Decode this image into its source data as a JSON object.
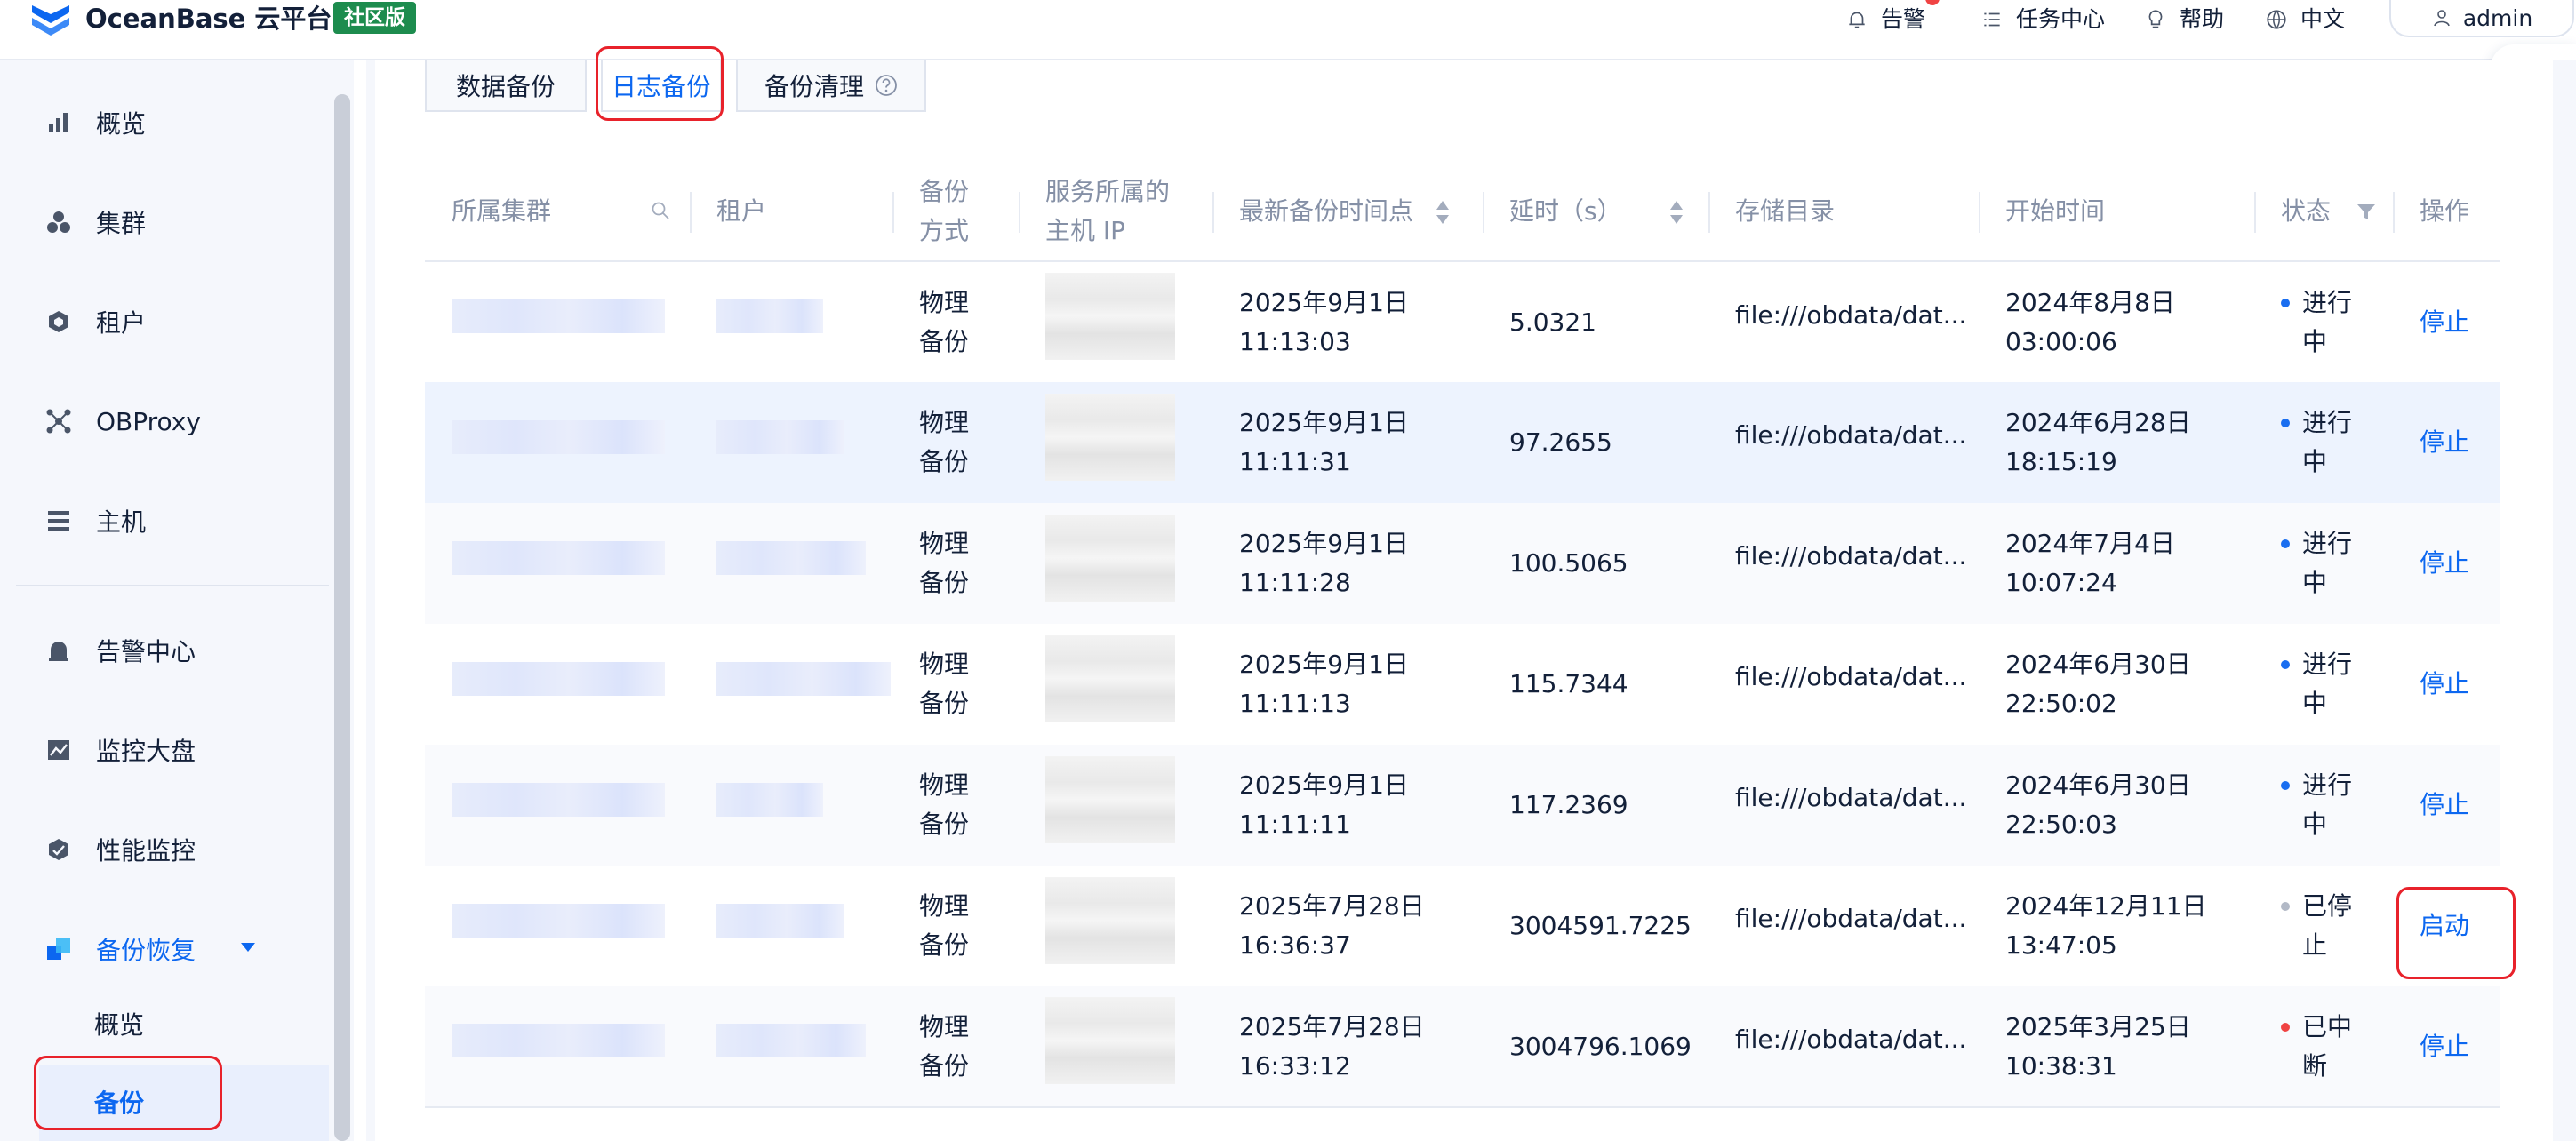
{
  "header": {
    "brand": "OceanBase 云平台",
    "edition_badge": "社区版",
    "alerts_label": "告警",
    "tasks_label": "任务中心",
    "help_label": "帮助",
    "language_label": "中文",
    "user_label": "admin"
  },
  "sidebar": {
    "items": [
      {
        "label": "概览",
        "icon": "bar-chart-icon"
      },
      {
        "label": "集群",
        "icon": "cluster-icon"
      },
      {
        "label": "租户",
        "icon": "tenant-icon"
      },
      {
        "label": "OBProxy",
        "icon": "proxy-icon"
      },
      {
        "label": "主机",
        "icon": "host-icon"
      },
      {
        "label": "告警中心",
        "icon": "alarm-icon"
      },
      {
        "label": "监控大盘",
        "icon": "monitor-icon"
      },
      {
        "label": "性能监控",
        "icon": "performance-icon"
      },
      {
        "label": "备份恢复",
        "icon": "backup-icon"
      }
    ],
    "sub_items": [
      {
        "label": "概览"
      },
      {
        "label": "备份"
      }
    ]
  },
  "tabs": [
    {
      "label": "数据备份"
    },
    {
      "label": "日志备份"
    },
    {
      "label": "备份清理"
    }
  ],
  "table": {
    "columns": [
      "所属集群",
      "租户",
      "备份方式",
      "服务所属的主机 IP",
      "最新备份时间点",
      "延时（s）",
      "存储目录",
      "开始时间",
      "状态",
      "操作"
    ],
    "rows": [
      {
        "method": "物理备份",
        "latest": "2025年9月1日 11:13:03",
        "delay": "5.0321",
        "dir": "file:///obdata/dat...",
        "start": "2024年8月8日 03:00:06",
        "status": "进行中",
        "status_color": "#1a6ef0",
        "action": "停止"
      },
      {
        "method": "物理备份",
        "latest": "2025年9月1日 11:11:31",
        "delay": "97.2655",
        "dir": "file:///obdata/dat...",
        "start": "2024年6月28日 18:15:19",
        "status": "进行中",
        "status_color": "#1a6ef0",
        "action": "停止"
      },
      {
        "method": "物理备份",
        "latest": "2025年9月1日 11:11:28",
        "delay": "100.5065",
        "dir": "file:///obdata/dat...",
        "start": "2024年7月4日 10:07:24",
        "status": "进行中",
        "status_color": "#1a6ef0",
        "action": "停止"
      },
      {
        "method": "物理备份",
        "latest": "2025年9月1日 11:11:13",
        "delay": "115.7344",
        "dir": "file:///obdata/dat...",
        "start": "2024年6月30日 22:50:02",
        "status": "进行中",
        "status_color": "#1a6ef0",
        "action": "停止"
      },
      {
        "method": "物理备份",
        "latest": "2025年9月1日 11:11:11",
        "delay": "117.2369",
        "dir": "file:///obdata/dat...",
        "start": "2024年6月30日 22:50:03",
        "status": "进行中",
        "status_color": "#1a6ef0",
        "action": "停止"
      },
      {
        "method": "物理备份",
        "latest": "2025年7月28日 16:36:37",
        "delay": "3004591.7225",
        "dir": "file:///obdata/dat...",
        "start": "2024年12月11日 13:47:05",
        "status": "已停止",
        "status_color": "#b2b9c6",
        "action": "启动"
      },
      {
        "method": "物理备份",
        "latest": "2025年7月28日 16:33:12",
        "delay": "3004796.1069",
        "dir": "file:///obdata/dat...",
        "start": "2025年3月25日 10:38:31",
        "status": "已中断",
        "status_color": "#f04343",
        "action": "停止"
      }
    ]
  }
}
